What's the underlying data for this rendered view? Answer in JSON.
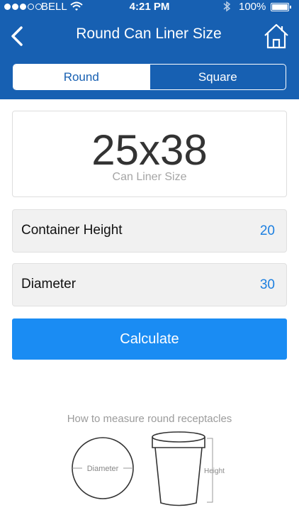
{
  "status_bar": {
    "carrier": "BELL",
    "time": "4:21 PM",
    "battery": "100%"
  },
  "nav": {
    "title": "Round Can Liner Size",
    "back_icon": "chevron-left-icon",
    "home_icon": "home-icon"
  },
  "segments": [
    {
      "label": "Round",
      "selected": true
    },
    {
      "label": "Square",
      "selected": false
    }
  ],
  "result": {
    "value": "25x38",
    "label": "Can Liner Size"
  },
  "fields": [
    {
      "label": "Container Height",
      "value": "20"
    },
    {
      "label": "Diameter",
      "value": "30"
    }
  ],
  "calculate_label": "Calculate",
  "howto": {
    "title": "How to measure round receptacles",
    "diameter_label": "Diameter",
    "height_label": "Height"
  },
  "colors": {
    "header": "#1760b2",
    "button": "#1a8cf3",
    "value_text": "#1c7fe0"
  }
}
